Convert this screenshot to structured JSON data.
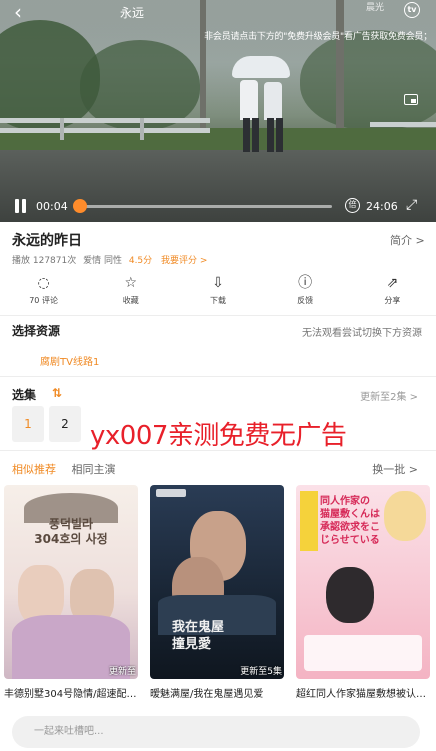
{
  "player": {
    "title": "永远",
    "brand_badge": "晨光",
    "marquee": "非会员请点击下方的\"免费升级会员\"看广告获取免费会员；",
    "current_time": "00:04",
    "total_time": "24:06",
    "progress_fraction": 0.003,
    "speed_label": "倍"
  },
  "show": {
    "title": "永远的昨日",
    "intro_link": "简介 >",
    "plays": "播放 127871次",
    "genre": "爱情 同性",
    "score": "4.5分",
    "rate_link": "我要评分 >"
  },
  "actions": [
    {
      "label": "70 评论",
      "icon": "comment-icon",
      "glyph": "◌"
    },
    {
      "label": "收藏",
      "icon": "star-icon",
      "glyph": "☆"
    },
    {
      "label": "下载",
      "icon": "download-icon",
      "glyph": "⇩"
    },
    {
      "label": "反馈",
      "icon": "feedback-icon",
      "glyph": "ⓘ"
    },
    {
      "label": "分享",
      "icon": "share-icon",
      "glyph": "⇗"
    }
  ],
  "resources": {
    "title": "选择资源",
    "hint": "无法观看尝试切换下方资源",
    "source": "腐剧TV线路1"
  },
  "episodes": {
    "title": "选集",
    "update": "更新至2集 >",
    "items": [
      "1",
      "2"
    ]
  },
  "ad_text": "yx007亲测免费无广告",
  "recommend": {
    "tabs": [
      "相似推荐",
      "相同主演"
    ],
    "refresh": "换一批 >",
    "items": [
      {
        "title": "丰德别墅304号隐情/超速配…",
        "tag": "更新至",
        "poster_text": "풍덕빌라\n304호의 사정",
        "bg": "#f4e9e7"
      },
      {
        "title": "暧魅满屋/我在鬼屋遇见爱",
        "tag": "更新至5集",
        "poster_text": "我在鬼屋\n撞見愛",
        "bg": "#1b2a3a"
      },
      {
        "title": "超红同人作家猫屋敷想被认…",
        "tag": "",
        "poster_text": "同人作家の\n猫屋敷くんは\n承認欲求をこじらせている",
        "bg": "#f7c9d4"
      }
    ]
  },
  "comment_placeholder": "一起来吐槽吧..."
}
